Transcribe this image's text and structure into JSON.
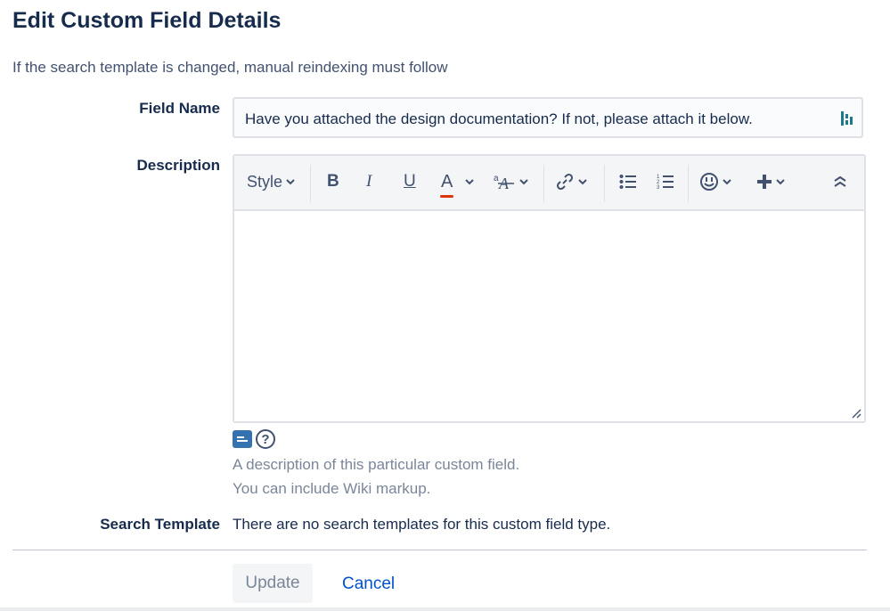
{
  "page": {
    "title": "Edit Custom Field Details",
    "subtitle": "If the search template is changed, manual reindexing must follow"
  },
  "field_name": {
    "label": "Field Name",
    "value": "Have you attached the design documentation? If not, please attach it below."
  },
  "description": {
    "label": "Description",
    "toolbar": {
      "style_label": "Style",
      "bold": "B",
      "italic": "I",
      "underline": "U",
      "text_color": "A",
      "text_color_underline": "#de350b",
      "icons": [
        "bold-icon",
        "italic-icon",
        "underline-icon",
        "text-color-icon",
        "text-effects-icon",
        "link-icon",
        "bullet-list-icon",
        "numbered-list-icon",
        "emoji-icon",
        "insert-icon",
        "collapse-icon"
      ]
    },
    "value": "",
    "hint_1": "A description of this particular custom field.",
    "hint_2": "You can include Wiki markup."
  },
  "search_template": {
    "label": "Search Template",
    "text": "There are no search templates for this custom field type."
  },
  "actions": {
    "update_label": "Update",
    "cancel_label": "Cancel"
  }
}
